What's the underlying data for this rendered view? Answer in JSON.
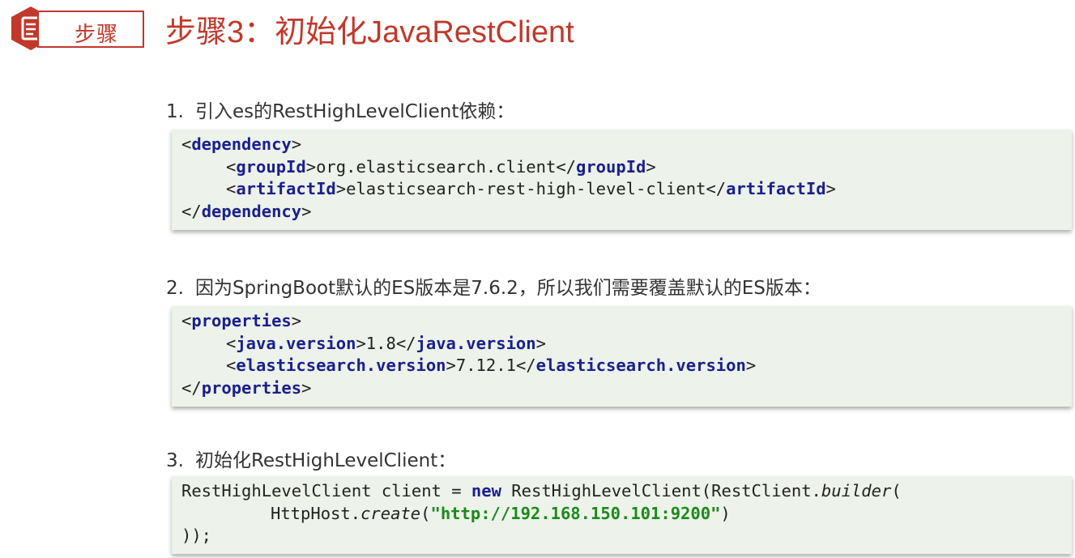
{
  "header": {
    "badge_label": "步骤",
    "title": "步骤3：初始化JavaRestClient"
  },
  "steps": [
    {
      "number": "1.",
      "text": "引入es的RestHighLevelClient依赖：",
      "code": {
        "open_tag": "dependency",
        "lines": [
          {
            "tag": "groupId",
            "value": "org.elasticsearch.client"
          },
          {
            "tag": "artifactId",
            "value": "elasticsearch-rest-high-level-client"
          }
        ]
      }
    },
    {
      "number": "2.",
      "text": "因为SpringBoot默认的ES版本是7.6.2，所以我们需要覆盖默认的ES版本：",
      "code": {
        "open_tag": "properties",
        "lines": [
          {
            "tag": "java.version",
            "value": "1.8"
          },
          {
            "tag": "elasticsearch.version",
            "value": "7.12.1"
          }
        ]
      }
    },
    {
      "number": "3.",
      "text": "初始化RestHighLevelClient：",
      "code": {
        "line1_a": "RestHighLevelClient client = ",
        "line1_kw": "new",
        "line1_b": " RestHighLevelClient(RestClient.",
        "line1_method": "builder",
        "line1_c": "(",
        "line2_a": "HttpHost.",
        "line2_method": "create",
        "line2_b": "(",
        "line2_str": "\"http://192.168.150.101:9200\"",
        "line2_c": ")",
        "line3": "));"
      }
    }
  ]
}
